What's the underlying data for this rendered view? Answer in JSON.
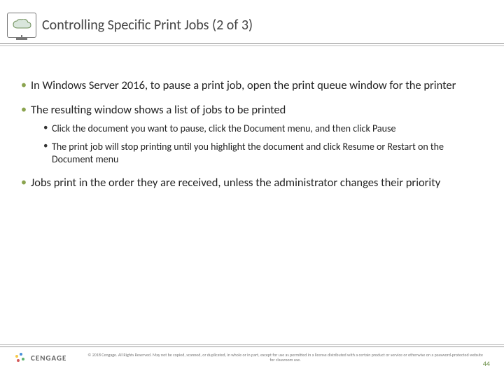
{
  "header": {
    "title": "Controlling Specific Print Jobs (2 of 3)"
  },
  "bullets": [
    {
      "text": "In Windows Server 2016, to pause a print job, open the print queue window for the printer",
      "sub": []
    },
    {
      "text": "The resulting window shows a list of jobs to be printed",
      "sub": [
        "Click the document you want to pause, click the Document menu, and then click Pause",
        "The print job will stop printing until you highlight the document and click Resume or Restart on the Document menu"
      ]
    },
    {
      "text": "Jobs print in the order they are received, unless the administrator changes their priority",
      "sub": []
    }
  ],
  "footer": {
    "brand": "CENGAGE",
    "copyright": "© 2018 Cengage. All Rights Reserved. May not be copied, scanned, or duplicated, in whole or in part, except for use as permitted in a license distributed with a certain product or service or otherwise on a password-protected website for classroom use.",
    "page": "44"
  }
}
